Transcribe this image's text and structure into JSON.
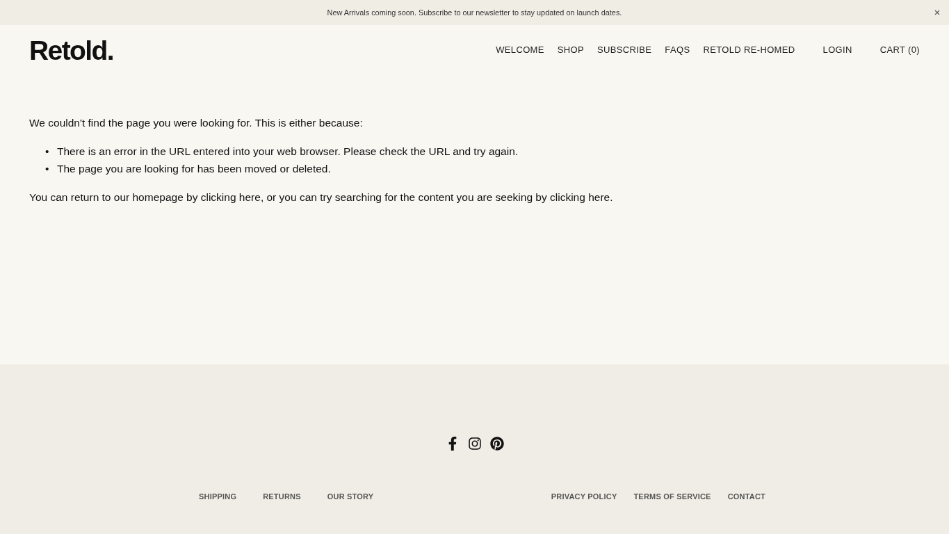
{
  "announcement_bar": {
    "text": "New Arrivals coming soon. Subscribe to our newsletter to stay updated on launch dates."
  },
  "header": {
    "logo": "Retold.",
    "nav": [
      "WELCOME",
      "SHOP",
      "SUBSCRIBE",
      "FAQS",
      "RETOLD RE-HOMED"
    ],
    "account": "LOGIN",
    "cart": "CART (0)"
  },
  "content": {
    "intro": "We couldn't find the page you were looking for. This is either because:",
    "reasons": [
      {
        "marker": "•",
        "text": "There is an error in the URL entered into your web browser. Please check the URL and try again."
      },
      {
        "marker": "•",
        "text": "The page you are looking for has been moved or deleted."
      }
    ],
    "followup": "You can return to our homepage by clicking here, or you can try searching for the content you are seeking by clicking here."
  },
  "footer": {
    "left_links": [
      "SHIPPING",
      "RETURNS",
      "OUR STORY"
    ],
    "right_links": [
      "PRIVACY POLICY",
      "TERMS OF SERVICE",
      "CONTACT"
    ]
  }
}
